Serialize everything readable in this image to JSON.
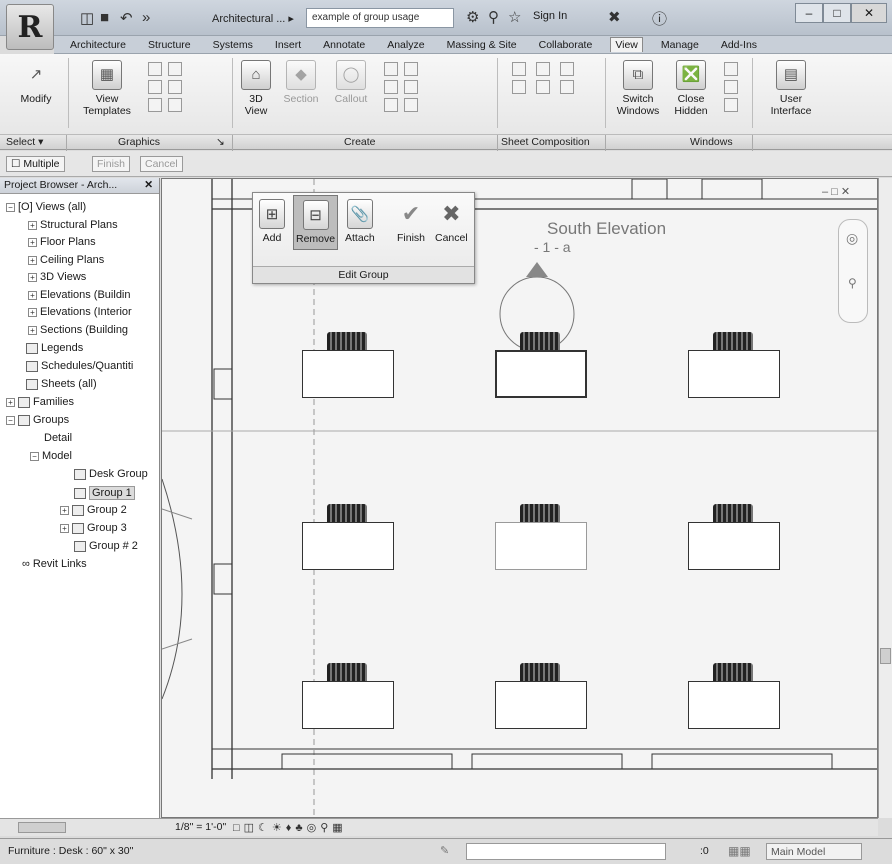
{
  "titlebar": {
    "app_menu_glyph": "R",
    "title": "Architectural ... ▸",
    "search_placeholder": "example of group usage",
    "sign_in": "Sign In",
    "icons": [
      "binoculars-icon",
      "key-icon",
      "star-icon",
      "user-icon",
      "help-icon"
    ]
  },
  "tabs": [
    "Architecture",
    "Structure",
    "Systems",
    "Insert",
    "Annotate",
    "Analyze",
    "Massing & Site",
    "Collaborate",
    "View",
    "Manage",
    "Add-Ins"
  ],
  "active_tab": "View",
  "ribbon": {
    "modify": "Modify",
    "view_templates": "View Templates",
    "view3d": "3D View",
    "section": "Section",
    "callout": "Callout",
    "switch_windows": "Switch Windows",
    "close_hidden": "Close Hidden",
    "user_interface": "User Interface",
    "panels": {
      "select": "Select ▾",
      "graphics": "Graphics",
      "create": "Create",
      "sheet": "Sheet Composition",
      "windows": "Windows"
    }
  },
  "options": {
    "multiple": "Multiple",
    "finish": "Finish",
    "cancel": "Cancel"
  },
  "browser": {
    "title": "Project Browser - Arch...",
    "close": "✕",
    "items": [
      {
        "label": "Views (all)"
      },
      {
        "label": "Structural Plans"
      },
      {
        "label": "Floor Plans"
      },
      {
        "label": "Ceiling Plans"
      },
      {
        "label": "3D Views"
      },
      {
        "label": "Elevations (Buildin"
      },
      {
        "label": "Elevations (Interior"
      },
      {
        "label": "Sections (Building"
      },
      {
        "label": "Legends"
      },
      {
        "label": "Schedules/Quantiti"
      },
      {
        "label": "Sheets (all)"
      },
      {
        "label": "Families"
      },
      {
        "label": "Groups"
      },
      {
        "label": "Detail"
      },
      {
        "label": "Model"
      },
      {
        "label": "Desk Group"
      },
      {
        "label": "Group 1"
      },
      {
        "label": "Group 2"
      },
      {
        "label": "Group 3"
      },
      {
        "label": "Group # 2"
      },
      {
        "label": "Revit Links"
      }
    ]
  },
  "edit_group": {
    "add": "Add",
    "remove": "Remove",
    "attach": "Attach",
    "finish": "Finish",
    "cancel": "Cancel",
    "panel": "Edit Group"
  },
  "canvas": {
    "elevation_title": "South Elevation",
    "elevation_sub": "- 1 - a"
  },
  "viewbar": {
    "scale": "1/8\" = 1'-0\""
  },
  "status": {
    "text": "Furniture : Desk : 60\" x 30\"",
    "zero": ":0",
    "model": "Main Model"
  }
}
